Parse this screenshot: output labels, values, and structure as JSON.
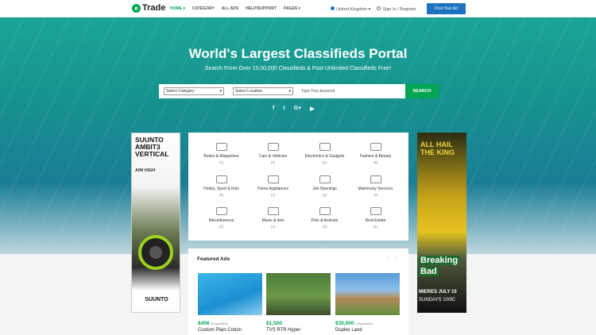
{
  "header": {
    "logo_text": "Trade",
    "logo_mark": "e",
    "nav": [
      "HOME ▾",
      "CATEGORY",
      "ALL ADS",
      "HELP/SUPPORT",
      "PAGES ▾"
    ],
    "country": "United Kingdom ▾",
    "signin": "Sign In / Register",
    "post_button": "Post Your Ad"
  },
  "hero": {
    "title": "World's Largest Classifieds Portal",
    "subtitle": "Search From Over 15,00,000 Classifieds & Post Unlimited Classifieds Free!",
    "search": {
      "category": "Select Category",
      "location": "Select Location",
      "keyword_placeholder": "Type Your keyword",
      "button": "SEARCH"
    },
    "social": [
      "f",
      "t",
      "G+",
      "▶"
    ]
  },
  "categories": [
    {
      "name": "Books & Magazines",
      "count": "(1)"
    },
    {
      "name": "Cars & Vehicles",
      "count": "(4)"
    },
    {
      "name": "Electronics & Gadgets",
      "count": "(6)"
    },
    {
      "name": "Fashion & Beauty",
      "count": "(5)"
    },
    {
      "name": "Hobby, Sport & Kids",
      "count": "(5)"
    },
    {
      "name": "Home Appliances",
      "count": "(1)"
    },
    {
      "name": "Job Openings",
      "count": "(4)"
    },
    {
      "name": "Matrimony Services",
      "count": "(2)"
    },
    {
      "name": "Miscellaneous",
      "count": "(2)"
    },
    {
      "name": "Music & Arts",
      "count": "(1)"
    },
    {
      "name": "Pets & Animals",
      "count": "(3)"
    },
    {
      "name": "Real Estate",
      "count": "(1)"
    }
  ],
  "featured": {
    "title": "Featured Ads",
    "ads": [
      {
        "price": "$456",
        "tag": "(Negotiable)",
        "name": "Custom Plain Cotton"
      },
      {
        "price": "$1,500",
        "tag": "",
        "name": "TVS RTR Hyper"
      },
      {
        "price": "$35,000",
        "tag": "(Negotiable)",
        "name": "Duplex Land"
      }
    ]
  },
  "ad_left": {
    "title": "SUUNTO AMBIT3 VERTICAL",
    "sub": "AIM HIGH",
    "brand": "SUUNTO"
  },
  "ad_right": {
    "title": "ALL HAIL THE KING",
    "logo_1": "Breaking",
    "logo_2": "Bad",
    "date": "MIERES JULY 15",
    "time": "SUNDAYS 10/9C"
  }
}
